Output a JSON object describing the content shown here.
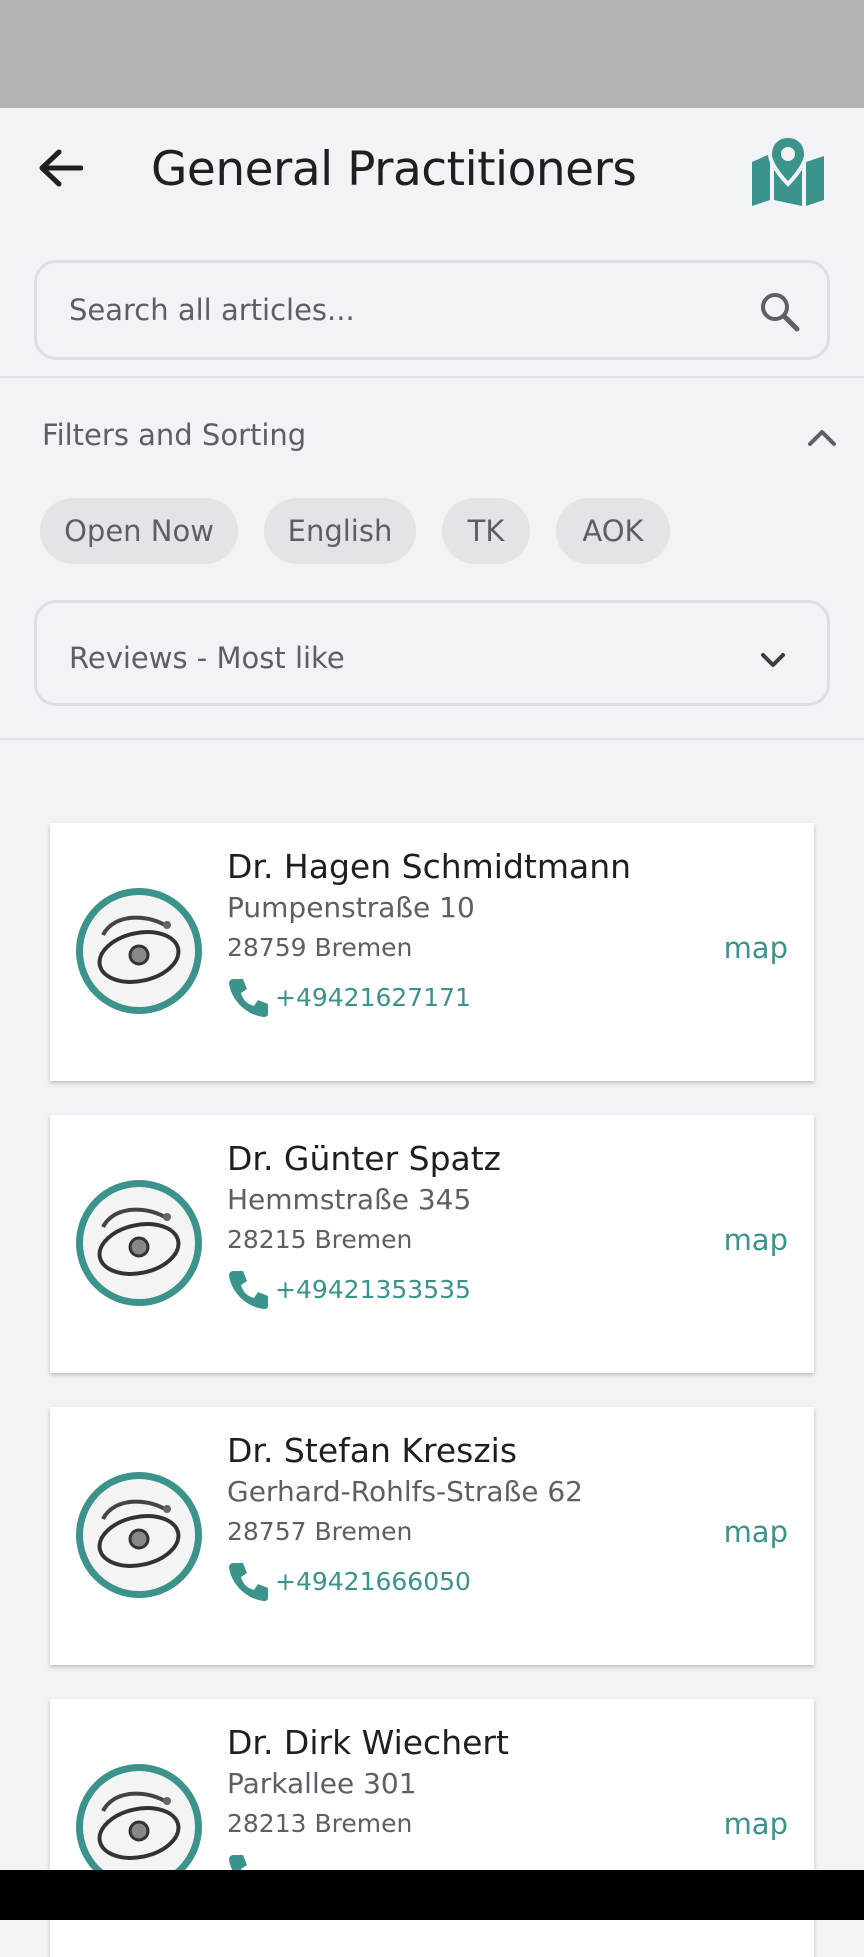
{
  "header": {
    "title": "General Practitioners"
  },
  "search": {
    "placeholder": "Search all articles..."
  },
  "filters": {
    "heading": "Filters and Sorting",
    "chips": [
      "Open Now",
      "English",
      "TK",
      "AOK"
    ],
    "sort_value": "Reviews - Most like"
  },
  "doctors": [
    {
      "name": "Dr. Hagen Schmidtmann",
      "street": "Pumpenstraße 10",
      "city": "28759 Bremen",
      "phone": "+49421627171",
      "map_label": "map"
    },
    {
      "name": "Dr. Günter Spatz",
      "street": "Hemmstraße 345",
      "city": "28215 Bremen",
      "phone": "+49421353535",
      "map_label": "map"
    },
    {
      "name": "Dr. Stefan Kreszis",
      "street": "Gerhard-Rohlfs-Straße 62",
      "city": "28757 Bremen",
      "phone": "+49421666050",
      "map_label": "map"
    },
    {
      "name": "Dr. Dirk Wiechert",
      "street": "Parkallee 301",
      "city": "28213 Bremen",
      "phone": "",
      "map_label": "map"
    }
  ],
  "icons": {
    "back": "arrow-left-icon",
    "map": "map-pin-icon",
    "search": "search-icon",
    "collapse": "chevron-up-icon",
    "dropdown": "chevron-down-icon",
    "phone": "phone-icon",
    "avatar": "stethoscope-image"
  },
  "colors": {
    "accent": "#3b938b",
    "background": "#f1f3f7",
    "chip": "#e2e4e8"
  }
}
